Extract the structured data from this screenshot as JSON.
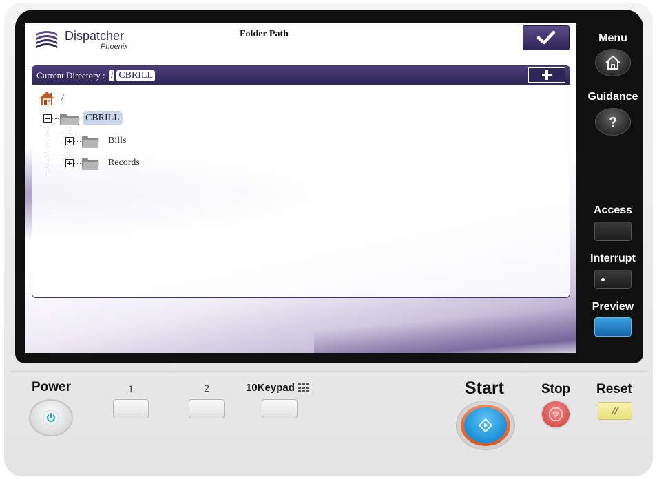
{
  "header": {
    "logo_name": "Dispatcher",
    "logo_sub": "Phoenix",
    "title": "Folder Path"
  },
  "directory": {
    "label": "Current Directory :",
    "separator": "/",
    "current": "CBRILL"
  },
  "tree": {
    "root": "/",
    "selected": "CBRILL",
    "children": [
      "Bills",
      "Records"
    ]
  },
  "side_panel": {
    "menu": "Menu",
    "guidance": "Guidance",
    "access": "Access",
    "interrupt": "Interrupt",
    "preview": "Preview"
  },
  "bottom_panel": {
    "power": "Power",
    "key1": "1",
    "key2": "2",
    "keypad": "10Keypad",
    "start": "Start",
    "stop": "Stop",
    "reset": "Reset"
  },
  "colors": {
    "accent": "#2e2656",
    "selected_bg": "#c9d6ec",
    "preview_blue": "#1f7cc8",
    "start_blue": "#1b8fd6",
    "stop_red": "#e05a5a",
    "reset_yellow": "#f2ee9a"
  },
  "icons": [
    "logo-mark-icon",
    "checkmark-icon",
    "plus-icon",
    "home-icon",
    "folder-icon",
    "house-icon",
    "question-icon",
    "power-icon",
    "keypad-icon",
    "start-icon",
    "stop-icon",
    "reset-icon"
  ]
}
